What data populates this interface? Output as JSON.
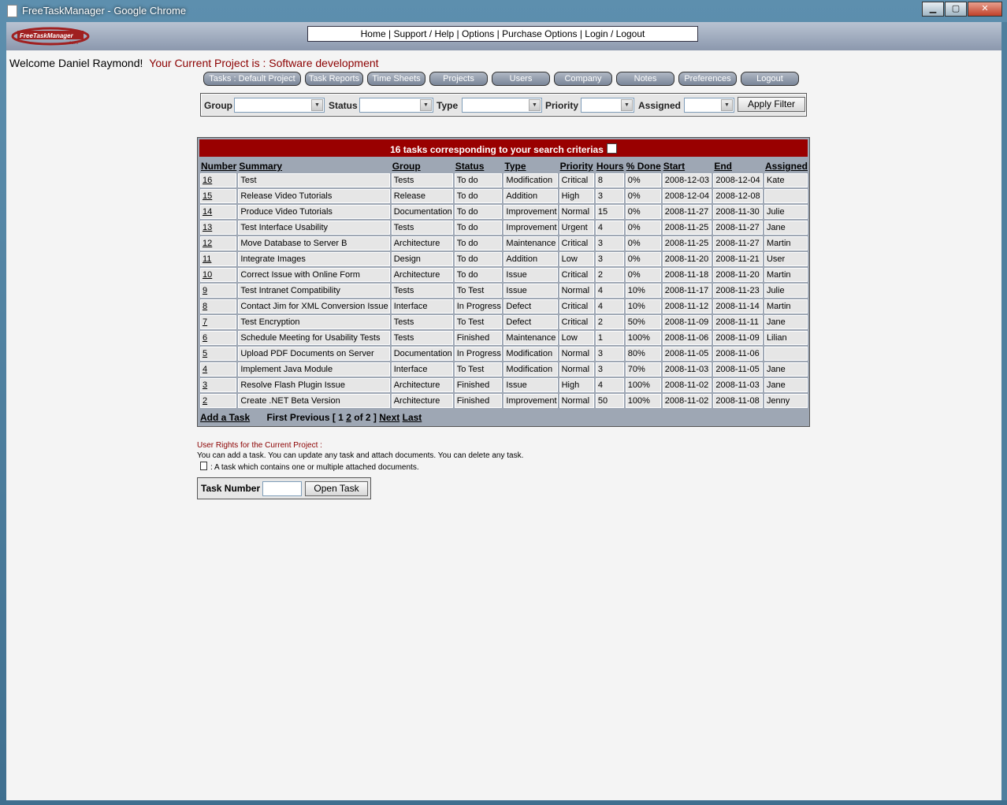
{
  "window": {
    "title": "FreeTaskManager - Google Chrome",
    "minimize": "▁",
    "maximize": "▢",
    "close": "✕"
  },
  "logo": {
    "text": "FreeTaskManager",
    "suffix": ".com"
  },
  "topnav": [
    "Home",
    "Support / Help",
    "Options",
    "Purchase Options",
    "Login / Logout"
  ],
  "welcome": {
    "greeting": "Welcome Daniel Raymond!",
    "project": "Your Current Project is : Software development"
  },
  "navbuttons": [
    "Tasks : Default Project",
    "Task Reports",
    "Time Sheets",
    "Projects",
    "Users",
    "Company",
    "Notes",
    "Preferences",
    "Logout"
  ],
  "filter": {
    "group": "Group",
    "status": "Status",
    "type": "Type",
    "priority": "Priority",
    "assigned": "Assigned",
    "apply": "Apply Filter"
  },
  "tasks": {
    "header": "16 tasks corresponding to your search criterias",
    "columns": [
      "Number",
      "Summary",
      "Group",
      "Status",
      "Type",
      "Priority",
      "Hours",
      "% Done",
      "Start",
      "End",
      "Assigned"
    ],
    "rows": [
      [
        "16",
        "Test",
        "Tests",
        "To do",
        "Modification",
        "Critical",
        "8",
        "0%",
        "2008-12-03",
        "2008-12-04",
        "Kate"
      ],
      [
        "15",
        "Release Video Tutorials",
        "Release",
        "To do",
        "Addition",
        "High",
        "3",
        "0%",
        "2008-12-04",
        "2008-12-08",
        ""
      ],
      [
        "14",
        "Produce Video Tutorials",
        "Documentation",
        "To do",
        "Improvement",
        "Normal",
        "15",
        "0%",
        "2008-11-27",
        "2008-11-30",
        "Julie"
      ],
      [
        "13",
        "Test Interface Usability",
        "Tests",
        "To do",
        "Improvement",
        "Urgent",
        "4",
        "0%",
        "2008-11-25",
        "2008-11-27",
        "Jane"
      ],
      [
        "12",
        "Move Database to Server B",
        "Architecture",
        "To do",
        "Maintenance",
        "Critical",
        "3",
        "0%",
        "2008-11-25",
        "2008-11-27",
        "Martin"
      ],
      [
        "11",
        "Integrate Images",
        "Design",
        "To do",
        "Addition",
        "Low",
        "3",
        "0%",
        "2008-11-20",
        "2008-11-21",
        "User"
      ],
      [
        "10",
        "Correct Issue with Online Form",
        "Architecture",
        "To do",
        "Issue",
        "Critical",
        "2",
        "0%",
        "2008-11-18",
        "2008-11-20",
        "Martin"
      ],
      [
        "9",
        "Test Intranet Compatibility",
        "Tests",
        "To Test",
        "Issue",
        "Normal",
        "4",
        "10%",
        "2008-11-17",
        "2008-11-23",
        "Julie"
      ],
      [
        "8",
        "Contact Jim for XML Conversion Issue",
        "Interface",
        "In Progress",
        "Defect",
        "Critical",
        "4",
        "10%",
        "2008-11-12",
        "2008-11-14",
        "Martin"
      ],
      [
        "7",
        "Test Encryption",
        "Tests",
        "To Test",
        "Defect",
        "Critical",
        "2",
        "50%",
        "2008-11-09",
        "2008-11-11",
        "Jane"
      ],
      [
        "6",
        "Schedule Meeting for Usability Tests",
        "Tests",
        "Finished",
        "Maintenance",
        "Low",
        "1",
        "100%",
        "2008-11-06",
        "2008-11-09",
        "Lilian"
      ],
      [
        "5",
        "Upload PDF Documents on Server",
        "Documentation",
        "In Progress",
        "Modification",
        "Normal",
        "3",
        "80%",
        "2008-11-05",
        "2008-11-06",
        ""
      ],
      [
        "4",
        "Implement Java Module",
        "Interface",
        "To Test",
        "Modification",
        "Normal",
        "3",
        "70%",
        "2008-11-03",
        "2008-11-05",
        "Jane"
      ],
      [
        "3",
        "Resolve Flash Plugin Issue",
        "Architecture",
        "Finished",
        "Issue",
        "High",
        "4",
        "100%",
        "2008-11-02",
        "2008-11-03",
        "Jane"
      ],
      [
        "2",
        "Create .NET Beta Version",
        "Architecture",
        "Finished",
        "Improvement",
        "Normal",
        "50",
        "100%",
        "2008-11-02",
        "2008-11-08",
        "Jenny"
      ]
    ],
    "add_task": "Add a Task",
    "pager": {
      "first_previous": "First Previous [ 1",
      "page2": "2",
      "of": "of 2 ]",
      "next": "Next",
      "last": "Last"
    }
  },
  "rights": {
    "title": "User Rights for the Current Project :",
    "text": "You can add a task. You can update any task and attach documents. You can delete any task.",
    "legend": ": A task which contains one or multiple attached documents."
  },
  "tasknumber": {
    "label": "Task Number",
    "button": "Open Task",
    "value": ""
  }
}
